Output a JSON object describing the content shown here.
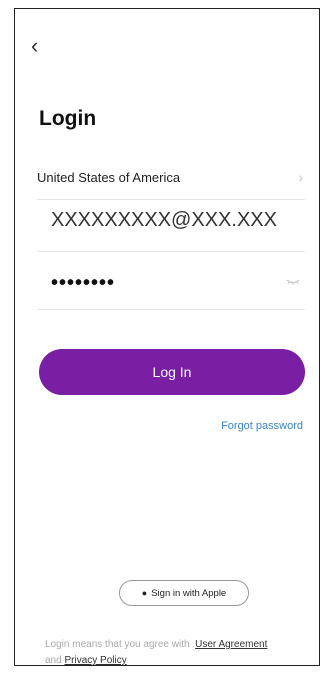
{
  "header": {
    "back_icon": "chevron-left-icon",
    "title": "Login"
  },
  "form": {
    "country": "United States of America",
    "email_value": "XXXXXXXXX@XXX.XXX",
    "password_mask": "••••••••"
  },
  "actions": {
    "login_label": "Log In",
    "forgot_label": "Forgot password",
    "apple_label": "Sign in with Apple"
  },
  "terms": {
    "prefix": "Login means that you agree with",
    "agreement": "User Agreement",
    "and": "and",
    "privacy": "Privacy Policy"
  },
  "colors": {
    "primary": "#7a1fa3",
    "link": "#3b86c9"
  }
}
